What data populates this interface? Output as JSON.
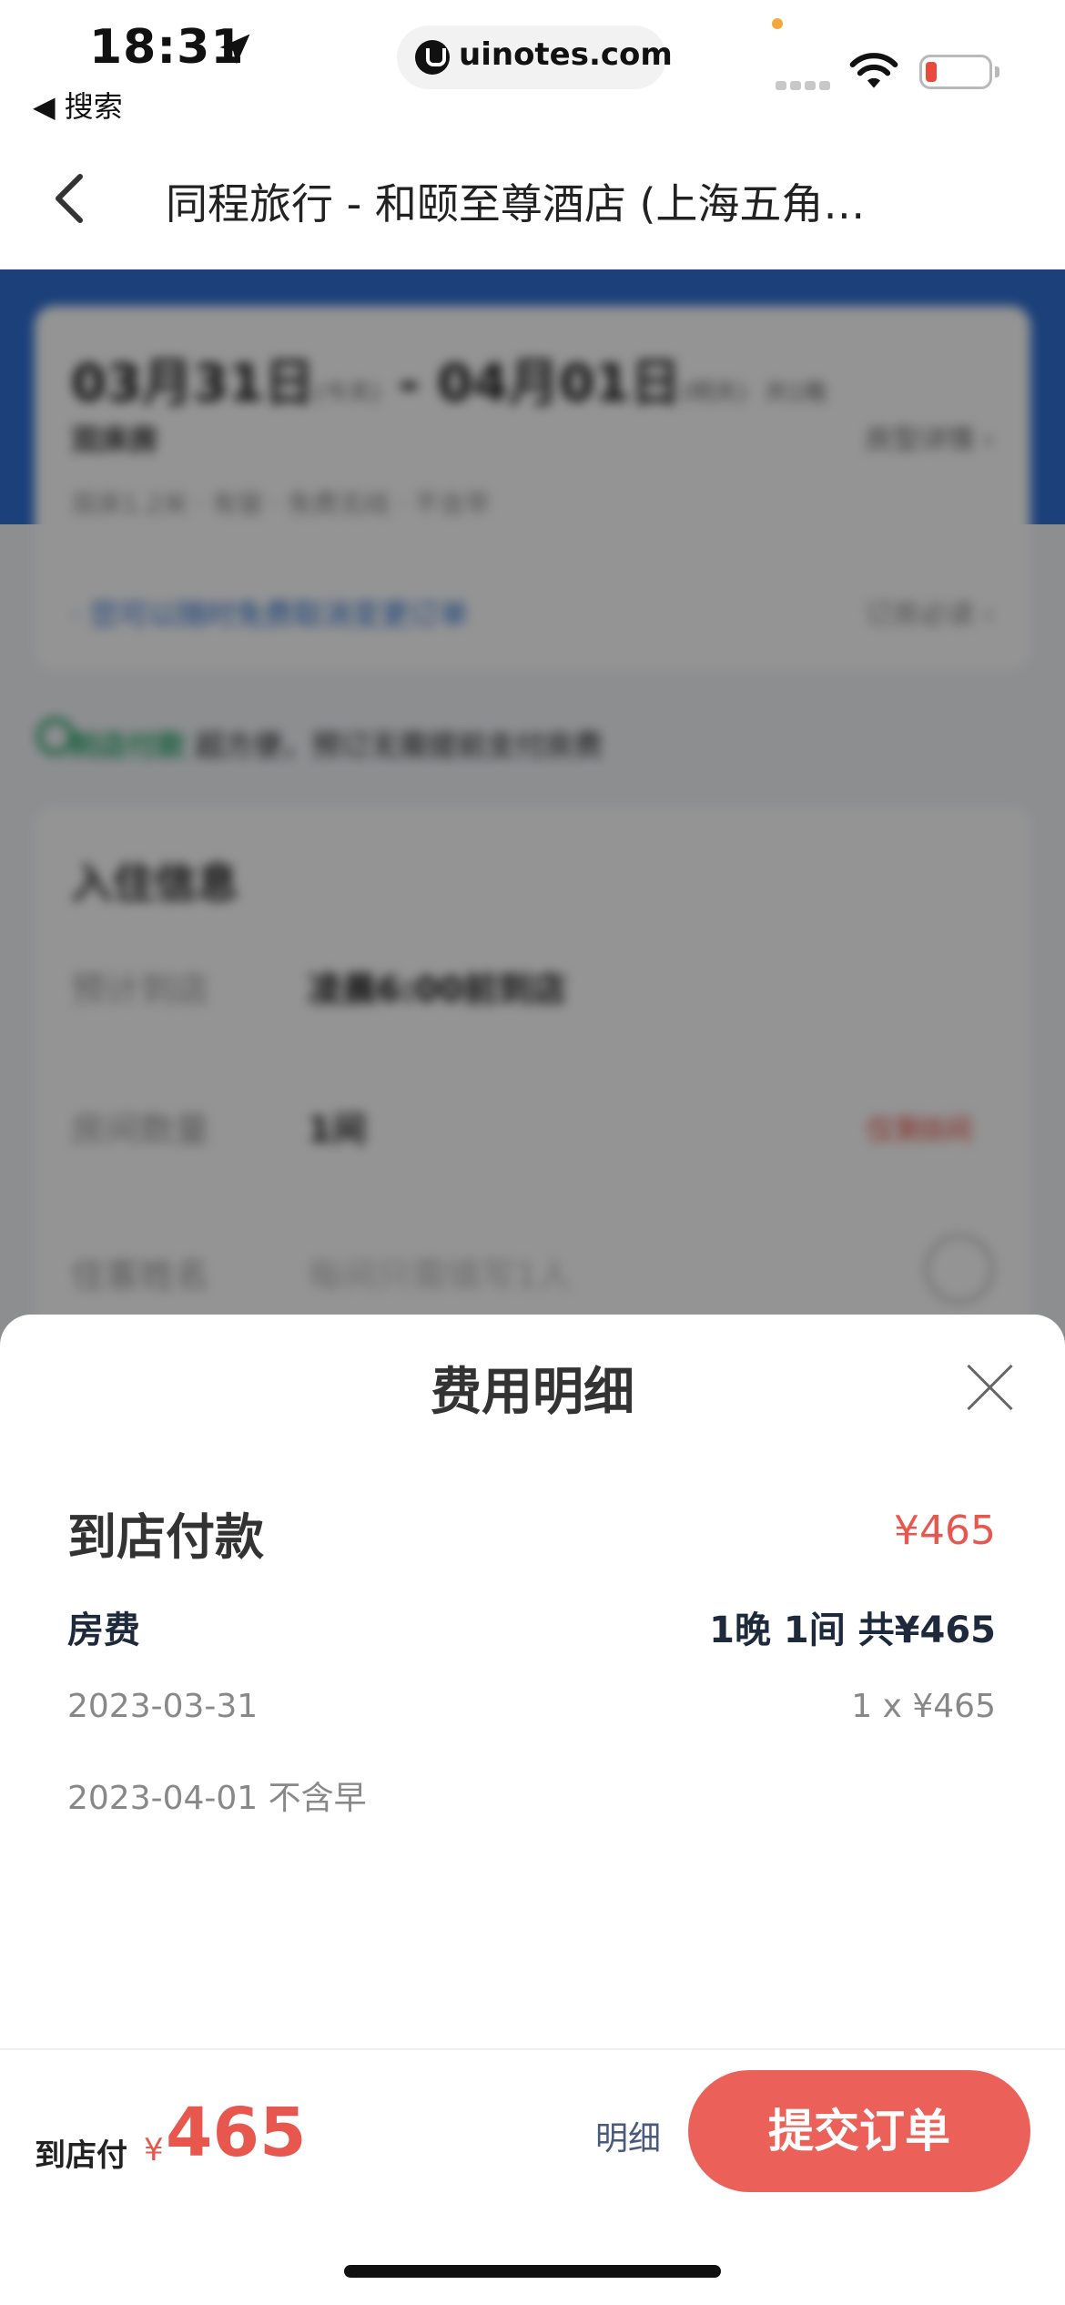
{
  "status_bar": {
    "time": "18:31",
    "back_label": "◀ 搜索",
    "url": "uinotes.com"
  },
  "nav": {
    "title": "同程旅行 - 和颐至尊酒店 (上海五角…"
  },
  "background_page": {
    "dates": "03月31日",
    "dates_today": "(今天)",
    "dates_sep": " - ",
    "dates_end": "04月01日",
    "dates_tomorrow": "(明天)",
    "nights": "共1晚",
    "room": "双床房",
    "room_detail": "房型详情 ›",
    "tags": "双床1.2米 · 有窗 · 免费无线 · 不含早",
    "cancel_note": "· 您可以随时免费取消变更订单",
    "notice": "订房必读 ›",
    "pay_method": "到店付款",
    "pay_note": "超方便，预订无需提前支付房费",
    "info_title": "入住信息",
    "rows": [
      {
        "label": "预计到店",
        "value": "凌晨6:00前到店"
      },
      {
        "label": "房间数量",
        "value": "1间",
        "extra": "仅剩8间"
      },
      {
        "label": "住客姓名",
        "value": "每间只需填写1人"
      }
    ]
  },
  "sheet": {
    "title": "费用明细",
    "section_title": "到店付款",
    "section_amount": "¥465",
    "item_label": "房费",
    "item_summary": "1晚 1间 共¥465",
    "dates": [
      {
        "date": "2023-03-31",
        "amount": "1 x ¥465"
      },
      {
        "date": "2023-04-01 不含早",
        "amount": ""
      }
    ]
  },
  "footer": {
    "pay_label": "到店付",
    "currency": "¥",
    "amount": "465",
    "detail_link": "明细",
    "submit_label": "提交订单"
  },
  "colors": {
    "accent_red": "#ec605a",
    "price_red": "#e8574e",
    "header_blue": "#2f6fd2",
    "online_green": "#27a36a"
  }
}
